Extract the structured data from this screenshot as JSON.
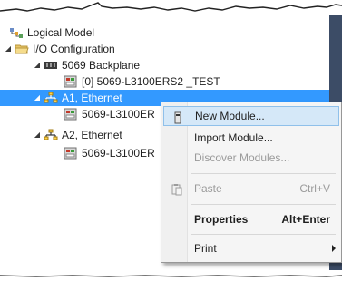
{
  "tree": {
    "logical_model": "Logical Model",
    "io_configuration": "I/O Configuration",
    "backplane": "5069 Backplane",
    "controller": "[0] 5069-L3100ERS2 _TEST",
    "a1": "A1, Ethernet",
    "a1_child": "5069-L3100ER",
    "a2": "A2, Ethernet",
    "a2_child": "5069-L3100ER"
  },
  "context_menu": {
    "new_module": "New Module...",
    "import_module": "Import Module...",
    "discover_modules": "Discover Modules...",
    "paste": "Paste",
    "paste_shortcut": "Ctrl+V",
    "properties": "Properties",
    "properties_shortcut": "Alt+Enter",
    "print": "Print"
  },
  "colors": {
    "selection": "#3399ff",
    "hover": "#d5e8f8",
    "right_bar": "#3c4c66"
  }
}
